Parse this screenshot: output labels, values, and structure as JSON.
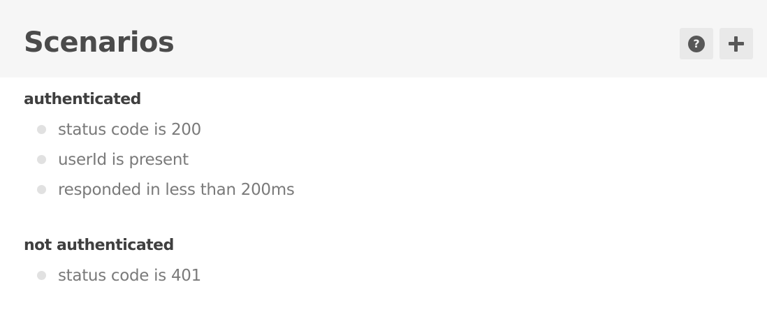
{
  "header": {
    "title": "Scenarios",
    "actions": [
      {
        "name": "help",
        "icon": "help-icon",
        "glyph": "?"
      },
      {
        "name": "add",
        "icon": "plus-icon"
      }
    ]
  },
  "scenarios": [
    {
      "name": "authenticated",
      "assertions": [
        "status code is 200",
        "userId is present",
        "responded in less than 200ms"
      ]
    },
    {
      "name": "not authenticated",
      "assertions": [
        "status code is 401"
      ]
    }
  ],
  "colors": {
    "header_background": "#f6f6f6",
    "button_background": "#e9e9e9",
    "icon": "#575757",
    "title_text": "#4b4b4b",
    "scenario_text": "#3f3f3f",
    "assertion_text": "#7a7a7a",
    "bullet": "#e1e1e1"
  }
}
